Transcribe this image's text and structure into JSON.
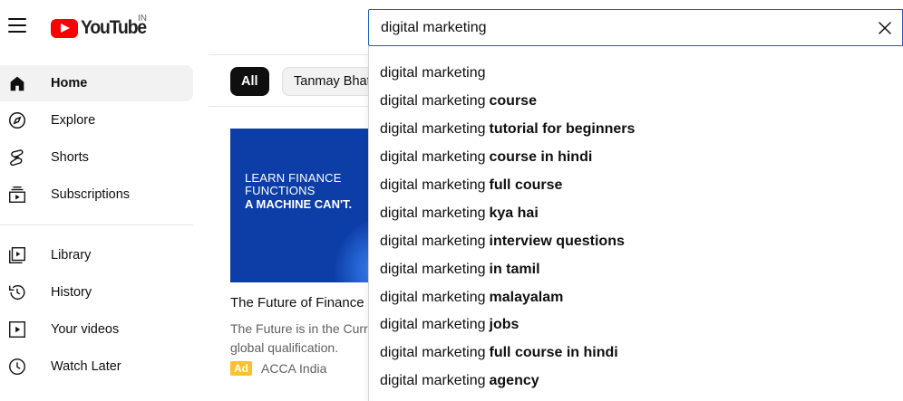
{
  "header": {
    "logo_text": "YouTube",
    "country_code": "IN",
    "search": {
      "value": "digital marketing",
      "placeholder": "Search"
    }
  },
  "sidebar": {
    "items": [
      {
        "label": "Home",
        "icon": "home-icon",
        "active": true
      },
      {
        "label": "Explore",
        "icon": "explore-icon"
      },
      {
        "label": "Shorts",
        "icon": "shorts-icon"
      },
      {
        "label": "Subscriptions",
        "icon": "subscriptions-icon"
      },
      {
        "label": "Library",
        "icon": "library-icon"
      },
      {
        "label": "History",
        "icon": "history-icon"
      },
      {
        "label": "Your videos",
        "icon": "your-videos-icon"
      },
      {
        "label": "Watch Later",
        "icon": "watch-later-icon"
      }
    ]
  },
  "chips": [
    {
      "label": "All",
      "active": true
    },
    {
      "label": "Tanmay Bhat"
    }
  ],
  "video": {
    "thumbnail": {
      "line1": "LEARN FINANCE",
      "line2": "FUNCTIONS",
      "line3": "A MACHINE CAN'T."
    },
    "title": "The Future of Finance is",
    "desc_line1": "The Future is in the Curr",
    "desc_line2": "global qualification.",
    "ad_label": "Ad",
    "channel": "ACCA India"
  },
  "suggestions": [
    {
      "prefix": "digital marketing",
      "suffix": ""
    },
    {
      "prefix": "digital marketing",
      "suffix": "course"
    },
    {
      "prefix": "digital marketing",
      "suffix": "tutorial for beginners"
    },
    {
      "prefix": "digital marketing",
      "suffix": "course in hindi"
    },
    {
      "prefix": "digital marketing",
      "suffix": "full course"
    },
    {
      "prefix": "digital marketing",
      "suffix": "kya hai"
    },
    {
      "prefix": "digital marketing",
      "suffix": "interview questions"
    },
    {
      "prefix": "digital marketing",
      "suffix": "in tamil"
    },
    {
      "prefix": "digital marketing",
      "suffix": "malayalam"
    },
    {
      "prefix": "digital marketing",
      "suffix": "jobs"
    },
    {
      "prefix": "digital marketing",
      "suffix": "full course in hindi"
    },
    {
      "prefix": "digital marketing",
      "suffix": "agency"
    }
  ],
  "colors": {
    "brand_red": "#ff0000",
    "search_focus": "#1c62b9",
    "ad_badge": "#fbc02d",
    "thumbnail_bg": "#0d3ea8"
  }
}
